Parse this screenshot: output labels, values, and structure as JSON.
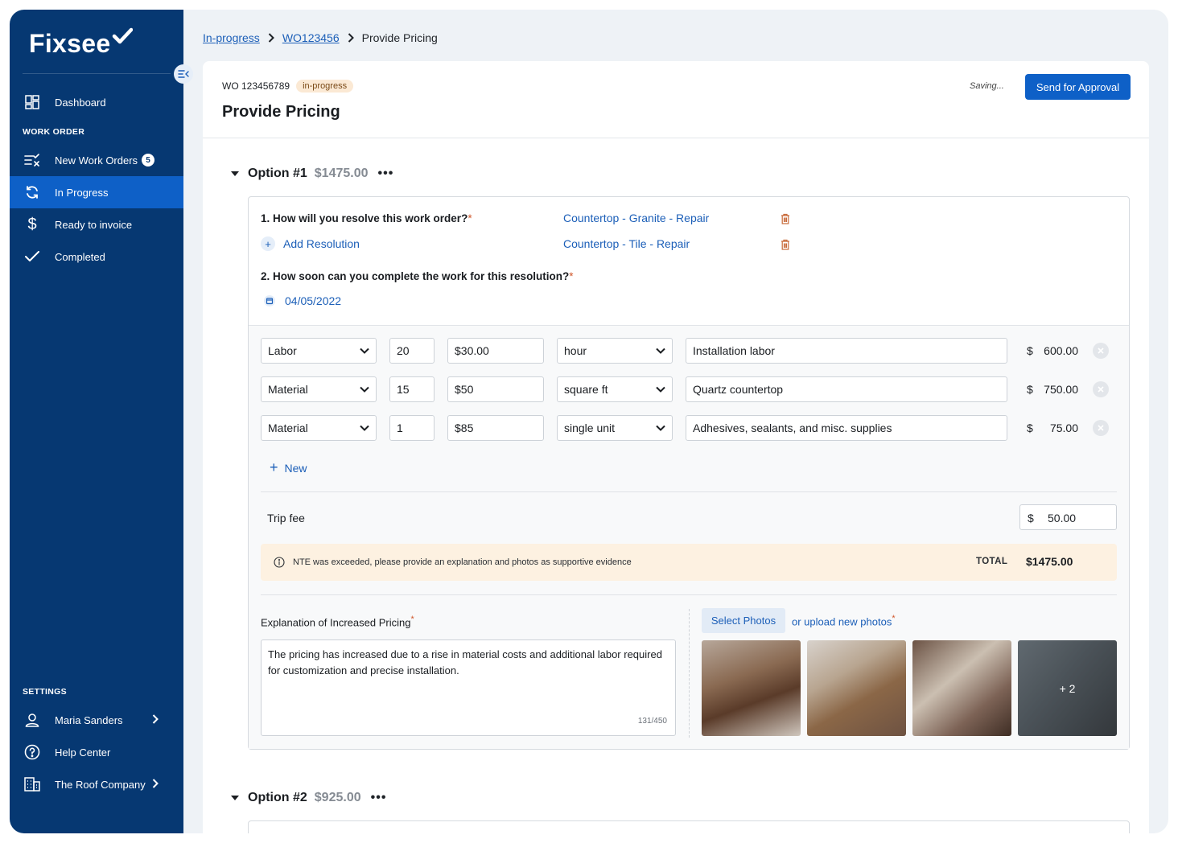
{
  "app": {
    "name": "Fixsee"
  },
  "sidebar": {
    "dashboard": "Dashboard",
    "work_order_section": "WORK ORDER",
    "items": [
      {
        "label": "New Work Orders",
        "badge": "5"
      },
      {
        "label": "In Progress"
      },
      {
        "label": "Ready to invoice"
      },
      {
        "label": "Completed"
      }
    ],
    "settings_section": "SETTINGS",
    "settings_items": [
      {
        "label": "Maria Sanders"
      },
      {
        "label": "Help Center"
      },
      {
        "label": "The Roof Company"
      }
    ]
  },
  "breadcrumb": {
    "root": "In-progress",
    "work_order": "WO123456",
    "current": "Provide Pricing"
  },
  "header": {
    "wo_number": "WO 123456789",
    "status": "in-progress",
    "title": "Provide Pricing",
    "saving": "Saving...",
    "send_button": "Send for Approval"
  },
  "option1": {
    "name": "Option #1",
    "price": "$1475.00",
    "q1": "1.  How will you resolve this work order?",
    "resolutions": [
      "Countertop - Granite - Repair",
      "Countertop - Tile - Repair"
    ],
    "add_resolution": "Add Resolution",
    "q2": "2. How soon can you complete the work for this resolution?",
    "date": "04/05/2022",
    "line_items": [
      {
        "type": "Labor",
        "qty": "20",
        "rate": "$30.00",
        "unit": "hour",
        "description": "Installation labor",
        "currency": "$",
        "amount": "600.00"
      },
      {
        "type": "Material",
        "qty": "15",
        "rate": "$50",
        "unit": "square ft",
        "description": "Quartz countertop",
        "currency": "$",
        "amount": "750.00"
      },
      {
        "type": "Material",
        "qty": "1",
        "rate": "$85",
        "unit": "single unit",
        "description": "Adhesives, sealants, and misc. supplies",
        "currency": "$",
        "amount": "75.00"
      }
    ],
    "new_label": "New",
    "trip_fee_label": "Trip fee",
    "trip_fee_currency": "$",
    "trip_fee": "50.00",
    "nte_message": "NTE was exceeded, please provide an explanation and photos as supportive evidence",
    "total_label": "TOTAL",
    "total": "$1475.00",
    "explanation_label": "Explanation of Increased Pricing",
    "explanation": "The pricing has increased due to a rise in material costs and additional labor required for customization and precise installation.",
    "char_count": "131/450",
    "select_photos": "Select Photos",
    "upload_photos": "or upload new photos",
    "more_photos": "+ 2"
  },
  "option2": {
    "name": "Option #2",
    "price": "$925.00"
  },
  "colors": {
    "sidebar": "#063872",
    "accent": "#0e60c7",
    "link": "#1c5fb8",
    "warning_bg": "#fdf1e1",
    "required": "#d0572b"
  }
}
